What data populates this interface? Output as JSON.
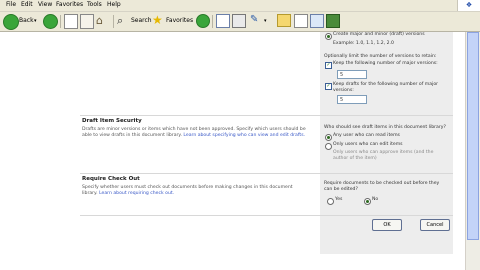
{
  "menu": [
    "File",
    "Edit",
    "View",
    "Favorites",
    "Tools",
    "Help"
  ],
  "toolbar": {
    "back": "Back",
    "search": "Search",
    "favorites": "Favorites"
  },
  "versioning": {
    "create_major_minor": "Create major and minor (draft) versions",
    "example": "Example: 1.0, 1.1, 1.2, 2.0",
    "optional_limit": "Optionally limit the number of versions to retain:",
    "keep_major": "Keep the following number of major versions:",
    "keep_major_value": "5",
    "keep_drafts": "Keep drafts for the following number of major versions:",
    "keep_drafts_value": "5"
  },
  "draft_security": {
    "title": "Draft Item Security",
    "desc": "Drafts are minor versions or items which have not been approved. Specify which users should be able to view drafts in this document library.",
    "link": "Learn about specifying who can view and edit drafts.",
    "question": "Who should see draft items in this document library?",
    "opt_read": "Any user who can read items",
    "opt_edit": "Only users who can edit items",
    "opt_approve": "Only users who can approve items (and the author of the item)"
  },
  "checkout": {
    "title": "Require Check Out",
    "desc": "Specify whether users must check out documents before making changes in this document library.",
    "link": "Learn about requiring check out.",
    "question": "Require documents to be checked out before they can be edited?",
    "yes": "Yes",
    "no": "No"
  },
  "buttons": {
    "ok": "OK",
    "cancel": "Cancel"
  }
}
